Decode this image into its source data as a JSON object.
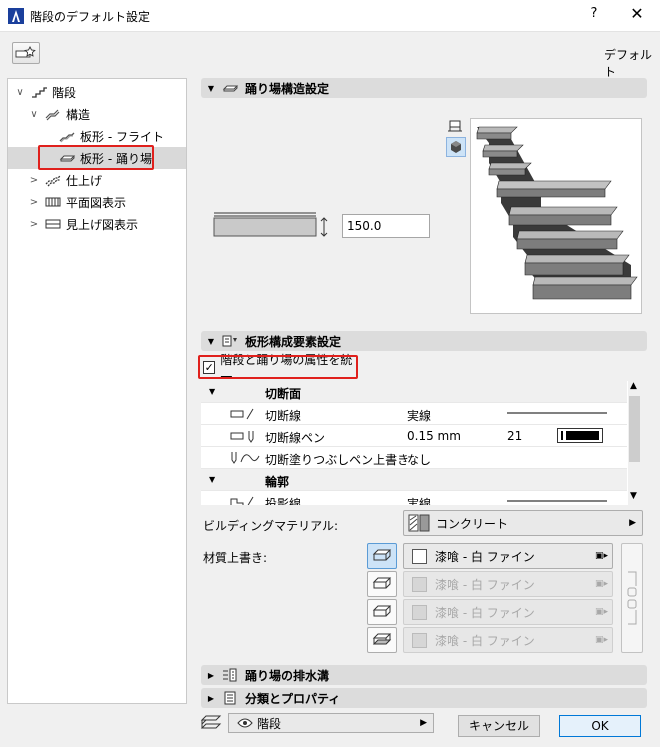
{
  "window": {
    "title": "階段のデフォルト設定",
    "help": "?",
    "close": "✕"
  },
  "toolbar": {
    "default_label": "デフォルト"
  },
  "tree": {
    "items": [
      {
        "label": "階段",
        "caret": "∨"
      },
      {
        "label": "構造",
        "caret": "∨"
      },
      {
        "label": "板形 - フライト",
        "caret": ""
      },
      {
        "label": "板形 - 踊り場",
        "caret": ""
      },
      {
        "label": "仕上げ",
        "caret": ">"
      },
      {
        "label": "平面図表示",
        "caret": ">"
      },
      {
        "label": "見上げ図表示",
        "caret": ">"
      }
    ]
  },
  "landing_structure": {
    "header": "踊り場構造設定",
    "thickness": "150.0"
  },
  "components": {
    "header": "板形構成要素設定",
    "unify_label": "階段と踊り場の属性を統一",
    "unify_checked": "✓",
    "groups": {
      "cut_surface": "切断面",
      "outline": "輪郭"
    },
    "rows": [
      {
        "label": "切断線",
        "value": "実線",
        "extra": ""
      },
      {
        "label": "切断線ペン",
        "value": "0.15 mm",
        "extra": "21"
      },
      {
        "label": "切断塗りつぶしペン上書き",
        "value": "なし",
        "extra": ""
      },
      {
        "label": "投影線",
        "value": "実線",
        "extra": ""
      }
    ]
  },
  "building_material": {
    "label": "ビルディングマテリアル:",
    "value": "コンクリート"
  },
  "material_override": {
    "label": "材質上書き:",
    "items": [
      "漆喰 - 白 ファイン",
      "漆喰 - 白 ファイン",
      "漆喰 - 白 ファイン",
      "漆喰 - 白 ファイン"
    ]
  },
  "sections": {
    "drainage": "踊り場の排水溝",
    "classification": "分類とプロパティ"
  },
  "footer": {
    "layer": "階段",
    "cancel": "キャンセル",
    "ok": "OK"
  },
  "colors": {
    "highlight": "#e0201c",
    "selection": "#cde3f7"
  }
}
